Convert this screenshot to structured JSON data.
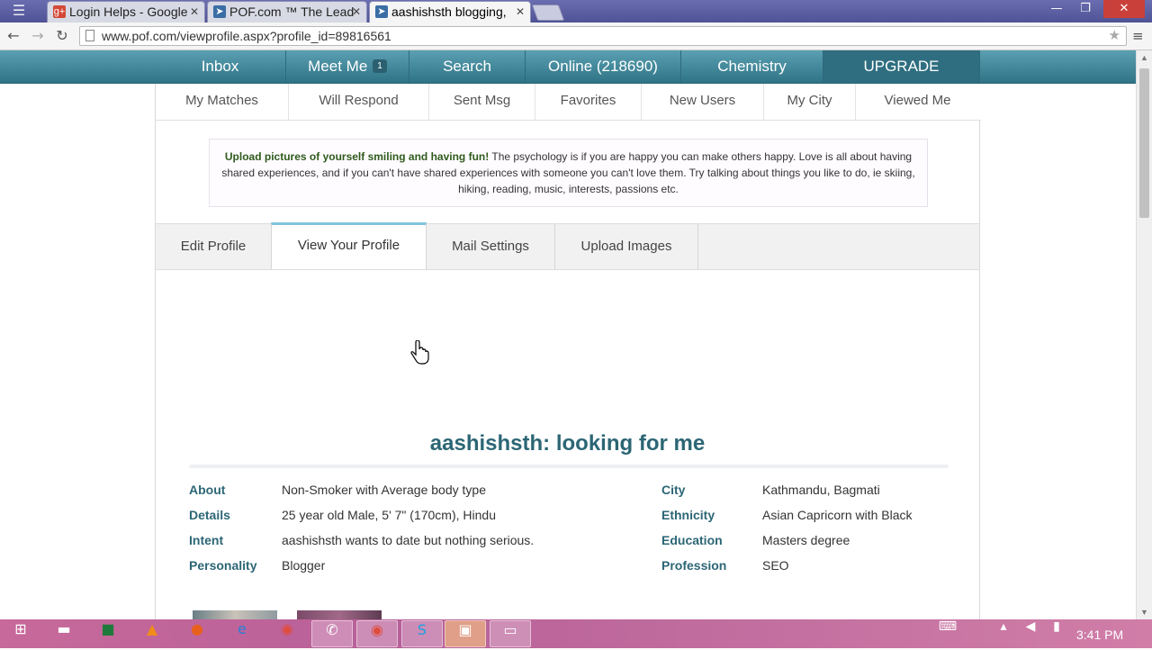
{
  "browser": {
    "tabs": [
      {
        "title": "Login Helps - Google",
        "icon": "google-plus-icon",
        "active": false
      },
      {
        "title": "POF.com ™ The Lead",
        "icon": "pof-fish-icon",
        "active": false
      },
      {
        "title": "aashishsth blogging,",
        "icon": "pof-fish-icon",
        "active": true
      }
    ],
    "url": "www.pof.com/viewprofile.aspx?profile_id=89816561"
  },
  "main_nav": [
    {
      "label": "Inbox"
    },
    {
      "label": "Meet Me",
      "badge": "1"
    },
    {
      "label": "Search"
    },
    {
      "label": "Online (218690)"
    },
    {
      "label": "Chemistry"
    },
    {
      "label": "UPGRADE"
    }
  ],
  "sub_nav": [
    "My Matches",
    "Will Respond",
    "Sent Msg",
    "Favorites",
    "New Users",
    "My City",
    "Viewed Me"
  ],
  "tip": {
    "bold": "Upload pictures of yourself smiling and having fun!",
    "text": " The psychology is if you are happy you can make others happy. Love is all about having shared experiences, and if you can't have shared experiences with someone you can't love them. Try talking about things you like to do, ie skiing, hiking, reading, music, interests, passions etc."
  },
  "profile_tabs": [
    "Edit Profile",
    "View Your Profile",
    "Mail Settings",
    "Upload Images"
  ],
  "profile_heading": "aashishsth: looking for me",
  "details_left": [
    {
      "label": "About",
      "value": "Non-Smoker with Average body type"
    },
    {
      "label": "Details",
      "value": "25 year old Male, 5' 7\" (170cm), Hindu"
    },
    {
      "label": "Intent",
      "value": "aashishsth wants to date but nothing serious."
    },
    {
      "label": "Personality",
      "value": "Blogger"
    }
  ],
  "details_right": [
    {
      "label": "City",
      "value": "Kathmandu, Bagmati"
    },
    {
      "label": "Ethnicity",
      "value": "Asian Capricorn with Black"
    },
    {
      "label": "Education",
      "value": "Masters degree"
    },
    {
      "label": "Profession",
      "value": "SEO"
    }
  ],
  "taskbar": {
    "apps": [
      "start-icon",
      "file-explorer-icon",
      "excel-icon",
      "vlc-icon",
      "firefox-icon",
      "internet-explorer-icon",
      "chrome-icon",
      "viber-icon",
      "chrome-icon",
      "skype-icon",
      "window-app-icon",
      "window-app-icon"
    ],
    "clock": "3:41 PM"
  },
  "colors": {
    "nav_teal": "#3f8496",
    "label_teal": "#2c6675",
    "tip_bold_green": "#2e5a1c",
    "active_tab_accent": "#82c4dc"
  }
}
